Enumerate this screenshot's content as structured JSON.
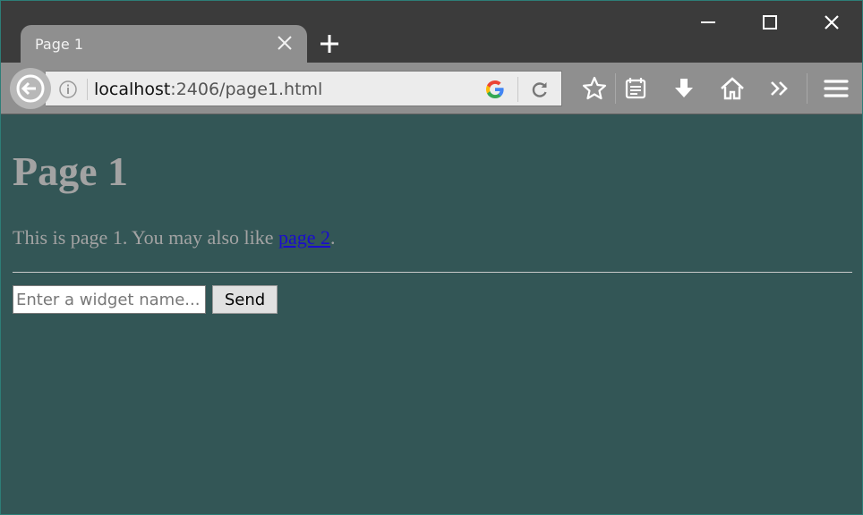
{
  "tab": {
    "title": "Page 1"
  },
  "address_bar": {
    "host": "localhost",
    "rest": ":2406/page1.html"
  },
  "page": {
    "heading": "Page 1",
    "paragraph_before": "This is page 1. You may also like ",
    "link_text": "page 2",
    "paragraph_after": "."
  },
  "form": {
    "placeholder": "Enter a widget name...",
    "send_label": "Send"
  },
  "colors": {
    "page_bg": "#335656",
    "text": "#a3a3a3",
    "link": "#1a0dcc"
  }
}
